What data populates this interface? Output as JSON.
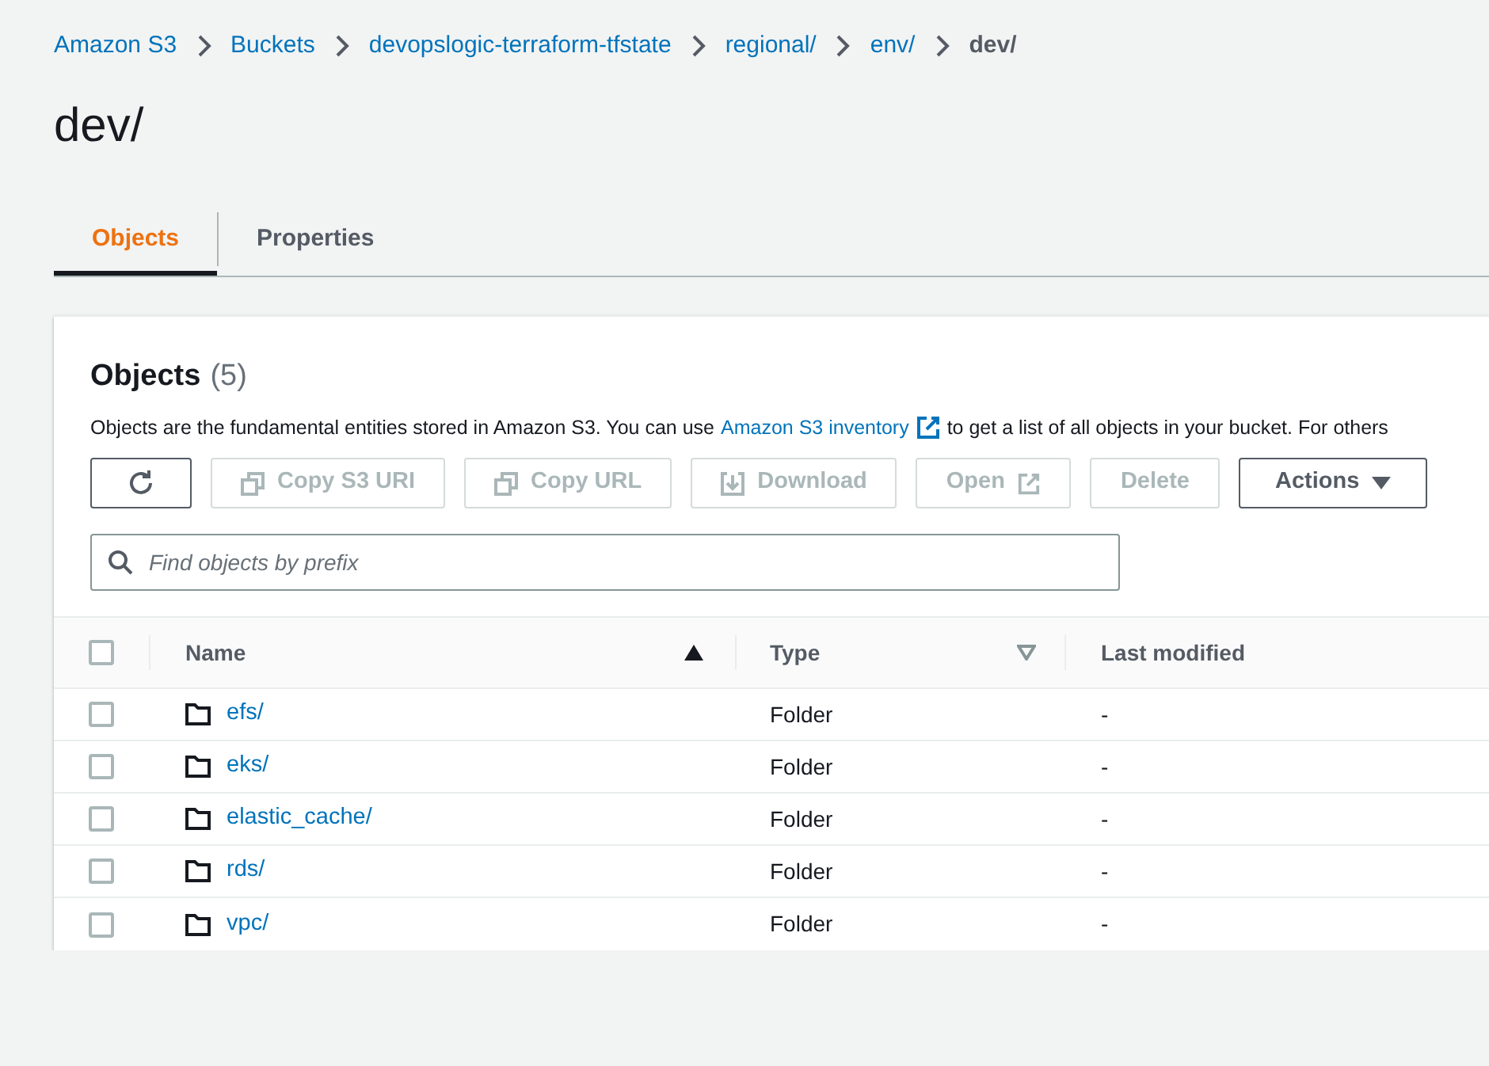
{
  "breadcrumbs": [
    {
      "label": "Amazon S3",
      "current": false
    },
    {
      "label": "Buckets",
      "current": false
    },
    {
      "label": "devopslogic-terraform-tfstate",
      "current": false
    },
    {
      "label": "regional/",
      "current": false
    },
    {
      "label": "env/",
      "current": false
    },
    {
      "label": "dev/",
      "current": true
    }
  ],
  "page_title": "dev/",
  "tabs": [
    {
      "label": "Objects",
      "selected": true
    },
    {
      "label": "Properties",
      "selected": false
    }
  ],
  "panel": {
    "title": "Objects",
    "count": "(5)",
    "description": {
      "before": "Objects are the fundamental entities stored in Amazon S3. You can use",
      "link": "Amazon S3 inventory",
      "after": "to get a list of all objects in your bucket. For others"
    },
    "buttons": [
      {
        "kind": "refresh",
        "disabled": false
      },
      {
        "kind": "copy",
        "label": "Copy S3 URI",
        "disabled": true
      },
      {
        "kind": "copy",
        "label": "Copy URL",
        "disabled": true
      },
      {
        "kind": "download",
        "label": "Download",
        "disabled": true
      },
      {
        "kind": "open",
        "label": "Open",
        "disabled": true
      },
      {
        "kind": "plain",
        "label": "Delete",
        "disabled": true
      },
      {
        "kind": "menu",
        "label": "Actions",
        "disabled": false
      }
    ],
    "search": {
      "placeholder": "Find objects by prefix"
    },
    "table": {
      "select_all": {
        "checked": false
      },
      "columns": [
        {
          "label": "Name",
          "sorted": true
        },
        {
          "label": "Type",
          "sorted": false
        },
        {
          "label": "Last modified"
        }
      ],
      "rows": [
        {
          "name": "efs/",
          "type": "Folder",
          "last_modified": "-",
          "checked": false
        },
        {
          "name": "eks/",
          "type": "Folder",
          "last_modified": "-",
          "checked": false
        },
        {
          "name": "elastic_cache/",
          "type": "Folder",
          "last_modified": "-",
          "checked": false
        },
        {
          "name": "rds/",
          "type": "Folder",
          "last_modified": "-",
          "checked": false
        },
        {
          "name": "vpc/",
          "type": "Folder",
          "last_modified": "-",
          "checked": false
        }
      ]
    }
  }
}
